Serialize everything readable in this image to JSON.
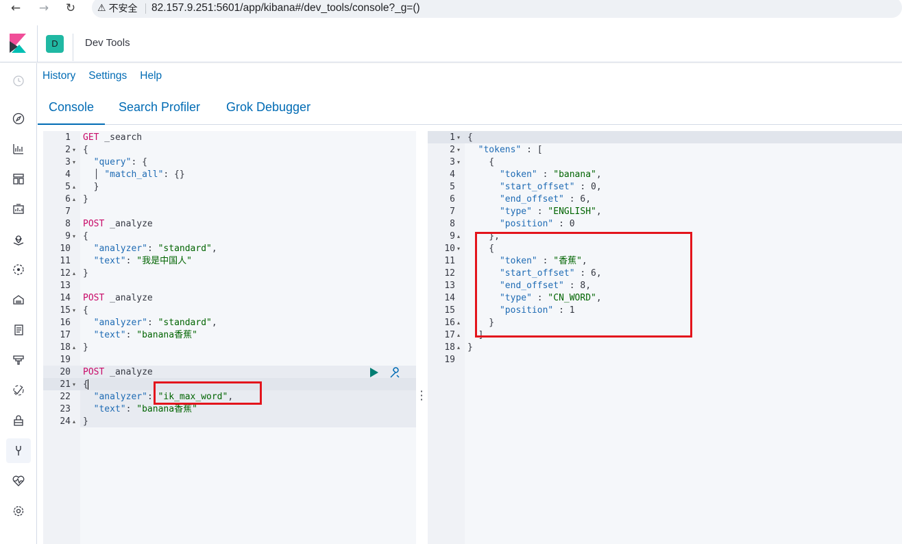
{
  "browser": {
    "back_icon": "←",
    "forward_icon": "→",
    "reload_icon": "↻",
    "insecure_icon": "⚠",
    "insecure_label": "不安全",
    "url": "82.157.9.251:5601/app/kibana#/dev_tools/console?_g=()"
  },
  "header": {
    "space_initial": "D",
    "title": "Dev Tools"
  },
  "toplinks": [
    "History",
    "Settings",
    "Help"
  ],
  "tabs": [
    "Console",
    "Search Profiler",
    "Grok Debugger"
  ],
  "request_lines": [
    {
      "n": "1",
      "fold": "",
      "parts": [
        [
          "kw",
          "GET"
        ],
        [
          "pl",
          " _search"
        ]
      ]
    },
    {
      "n": "2",
      "fold": "▾",
      "parts": [
        [
          "pl",
          "{"
        ]
      ]
    },
    {
      "n": "3",
      "fold": "▾",
      "parts": [
        [
          "pl",
          "  "
        ],
        [
          "key",
          "\"query\""
        ],
        [
          "pl",
          ": {"
        ]
      ]
    },
    {
      "n": "4",
      "fold": "",
      "parts": [
        [
          "pl",
          "  │ "
        ],
        [
          "key",
          "\"match_all\""
        ],
        [
          "pl",
          ": {}"
        ]
      ]
    },
    {
      "n": "5",
      "fold": "▴",
      "parts": [
        [
          "pl",
          "  }"
        ]
      ]
    },
    {
      "n": "6",
      "fold": "▴",
      "parts": [
        [
          "pl",
          "}"
        ]
      ]
    },
    {
      "n": "7",
      "fold": "",
      "parts": []
    },
    {
      "n": "8",
      "fold": "",
      "parts": [
        [
          "kw",
          "POST"
        ],
        [
          "pl",
          " _analyze"
        ]
      ]
    },
    {
      "n": "9",
      "fold": "▾",
      "parts": [
        [
          "pl",
          "{"
        ]
      ]
    },
    {
      "n": "10",
      "fold": "",
      "parts": [
        [
          "pl",
          "  "
        ],
        [
          "key",
          "\"analyzer\""
        ],
        [
          "pl",
          ": "
        ],
        [
          "str",
          "\"standard\""
        ],
        [
          "pl",
          ","
        ]
      ]
    },
    {
      "n": "11",
      "fold": "",
      "parts": [
        [
          "pl",
          "  "
        ],
        [
          "key",
          "\"text\""
        ],
        [
          "pl",
          ": "
        ],
        [
          "str",
          "\"我是中国人\""
        ]
      ]
    },
    {
      "n": "12",
      "fold": "▴",
      "parts": [
        [
          "pl",
          "}"
        ]
      ]
    },
    {
      "n": "13",
      "fold": "",
      "parts": []
    },
    {
      "n": "14",
      "fold": "",
      "parts": [
        [
          "kw",
          "POST"
        ],
        [
          "pl",
          " _analyze"
        ]
      ]
    },
    {
      "n": "15",
      "fold": "▾",
      "parts": [
        [
          "pl",
          "{"
        ]
      ]
    },
    {
      "n": "16",
      "fold": "",
      "parts": [
        [
          "pl",
          "  "
        ],
        [
          "key",
          "\"analyzer\""
        ],
        [
          "pl",
          ": "
        ],
        [
          "str",
          "\"standard\""
        ],
        [
          "pl",
          ","
        ]
      ]
    },
    {
      "n": "17",
      "fold": "",
      "parts": [
        [
          "pl",
          "  "
        ],
        [
          "key",
          "\"text\""
        ],
        [
          "pl",
          ": "
        ],
        [
          "str",
          "\"banana香蕉\""
        ]
      ]
    },
    {
      "n": "18",
      "fold": "▴",
      "parts": [
        [
          "pl",
          "}"
        ]
      ]
    },
    {
      "n": "19",
      "fold": "",
      "parts": []
    },
    {
      "n": "20",
      "fold": "",
      "parts": [
        [
          "kw",
          "POST"
        ],
        [
          "pl",
          " _analyze"
        ]
      ]
    },
    {
      "n": "21",
      "fold": "▾",
      "parts": [
        [
          "pl",
          "{"
        ]
      ]
    },
    {
      "n": "22",
      "fold": "",
      "parts": [
        [
          "pl",
          "  "
        ],
        [
          "key",
          "\"analyzer\""
        ],
        [
          "pl",
          ": "
        ],
        [
          "str",
          "\"ik_max_word\""
        ],
        [
          "pl",
          ","
        ]
      ]
    },
    {
      "n": "23",
      "fold": "",
      "parts": [
        [
          "pl",
          "  "
        ],
        [
          "key",
          "\"text\""
        ],
        [
          "pl",
          ": "
        ],
        [
          "str",
          "\"banana香蕉\""
        ]
      ]
    },
    {
      "n": "24",
      "fold": "▴",
      "parts": [
        [
          "pl",
          "}"
        ]
      ]
    }
  ],
  "response_lines": [
    {
      "n": "1",
      "fold": "▾",
      "parts": [
        [
          "pl",
          "{"
        ]
      ]
    },
    {
      "n": "2",
      "fold": "▾",
      "parts": [
        [
          "pl",
          "  "
        ],
        [
          "key",
          "\"tokens\""
        ],
        [
          "pl",
          " : ["
        ]
      ]
    },
    {
      "n": "3",
      "fold": "▾",
      "parts": [
        [
          "pl",
          "    {"
        ]
      ]
    },
    {
      "n": "4",
      "fold": "",
      "parts": [
        [
          "pl",
          "      "
        ],
        [
          "key",
          "\"token\""
        ],
        [
          "pl",
          " : "
        ],
        [
          "str",
          "\"banana\""
        ],
        [
          "pl",
          ","
        ]
      ]
    },
    {
      "n": "5",
      "fold": "",
      "parts": [
        [
          "pl",
          "      "
        ],
        [
          "key",
          "\"start_offset\""
        ],
        [
          "pl",
          " : 0,"
        ]
      ]
    },
    {
      "n": "6",
      "fold": "",
      "parts": [
        [
          "pl",
          "      "
        ],
        [
          "key",
          "\"end_offset\""
        ],
        [
          "pl",
          " : 6,"
        ]
      ]
    },
    {
      "n": "7",
      "fold": "",
      "parts": [
        [
          "pl",
          "      "
        ],
        [
          "key",
          "\"type\""
        ],
        [
          "pl",
          " : "
        ],
        [
          "str",
          "\"ENGLISH\""
        ],
        [
          "pl",
          ","
        ]
      ]
    },
    {
      "n": "8",
      "fold": "",
      "parts": [
        [
          "pl",
          "      "
        ],
        [
          "key",
          "\"position\""
        ],
        [
          "pl",
          " : 0"
        ]
      ]
    },
    {
      "n": "9",
      "fold": "▴",
      "parts": [
        [
          "pl",
          "    },"
        ]
      ]
    },
    {
      "n": "10",
      "fold": "▾",
      "parts": [
        [
          "pl",
          "    {"
        ]
      ]
    },
    {
      "n": "11",
      "fold": "",
      "parts": [
        [
          "pl",
          "      "
        ],
        [
          "key",
          "\"token\""
        ],
        [
          "pl",
          " : "
        ],
        [
          "str",
          "\"香蕉\""
        ],
        [
          "pl",
          ","
        ]
      ]
    },
    {
      "n": "12",
      "fold": "",
      "parts": [
        [
          "pl",
          "      "
        ],
        [
          "key",
          "\"start_offset\""
        ],
        [
          "pl",
          " : 6,"
        ]
      ]
    },
    {
      "n": "13",
      "fold": "",
      "parts": [
        [
          "pl",
          "      "
        ],
        [
          "key",
          "\"end_offset\""
        ],
        [
          "pl",
          " : 8,"
        ]
      ]
    },
    {
      "n": "14",
      "fold": "",
      "parts": [
        [
          "pl",
          "      "
        ],
        [
          "key",
          "\"type\""
        ],
        [
          "pl",
          " : "
        ],
        [
          "str",
          "\"CN_WORD\""
        ],
        [
          "pl",
          ","
        ]
      ]
    },
    {
      "n": "15",
      "fold": "",
      "parts": [
        [
          "pl",
          "      "
        ],
        [
          "key",
          "\"position\""
        ],
        [
          "pl",
          " : 1"
        ]
      ]
    },
    {
      "n": "16",
      "fold": "▴",
      "parts": [
        [
          "pl",
          "    }"
        ]
      ]
    },
    {
      "n": "17",
      "fold": "▴",
      "parts": [
        [
          "pl",
          "  ]"
        ]
      ]
    },
    {
      "n": "18",
      "fold": "▴",
      "parts": [
        [
          "pl",
          "}"
        ]
      ]
    },
    {
      "n": "19",
      "fold": "",
      "parts": []
    }
  ],
  "colors": {
    "accent": "#006bb4",
    "keyword": "#c80a68",
    "string": "#006400",
    "highlight_box": "#e3141c",
    "space_badge": "#20b8a3",
    "play": "#017d73"
  }
}
